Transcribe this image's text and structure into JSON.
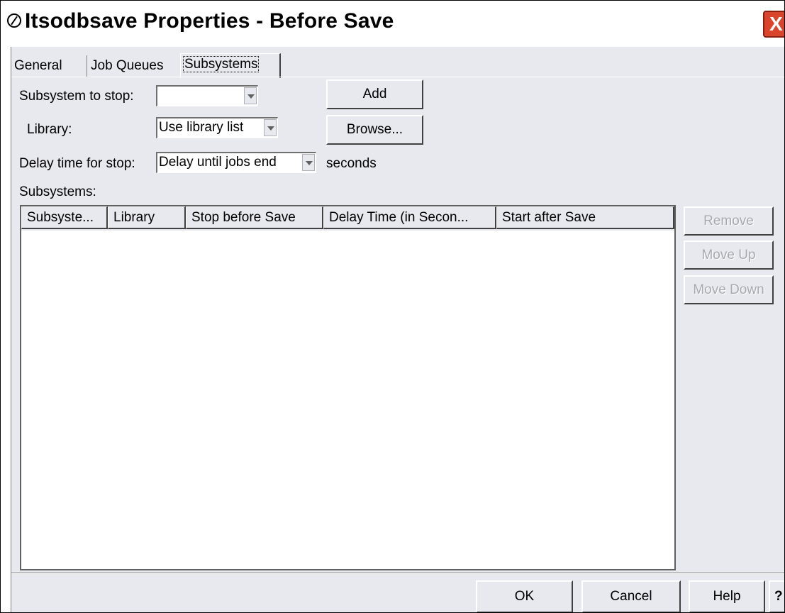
{
  "window": {
    "title": "Itsodbsave Properties - Before Save",
    "close_glyph": "X"
  },
  "tabs": [
    {
      "label": "General"
    },
    {
      "label": "Job Queues"
    },
    {
      "label": "Subsystems"
    }
  ],
  "form": {
    "subsystem_to_stop_label": "Subsystem to stop:",
    "subsystem_to_stop_value": "",
    "library_label": "Library:",
    "library_value": "Use library list",
    "delay_label": "Delay time for stop:",
    "delay_value": "Delay until jobs end",
    "delay_unit": "seconds",
    "add_button": "Add",
    "browse_button": "Browse..."
  },
  "subsystems": {
    "label": "Subsystems:",
    "columns": [
      "Subsyste...",
      "Library",
      "Stop before Save",
      "Delay Time (in Secon...",
      "Start after Save"
    ],
    "rows": []
  },
  "side_buttons": {
    "remove": "Remove",
    "move_up": "Move Up",
    "move_down": "Move Down"
  },
  "footer": {
    "ok": "OK",
    "cancel": "Cancel",
    "help": "Help",
    "whats_this": "?"
  }
}
